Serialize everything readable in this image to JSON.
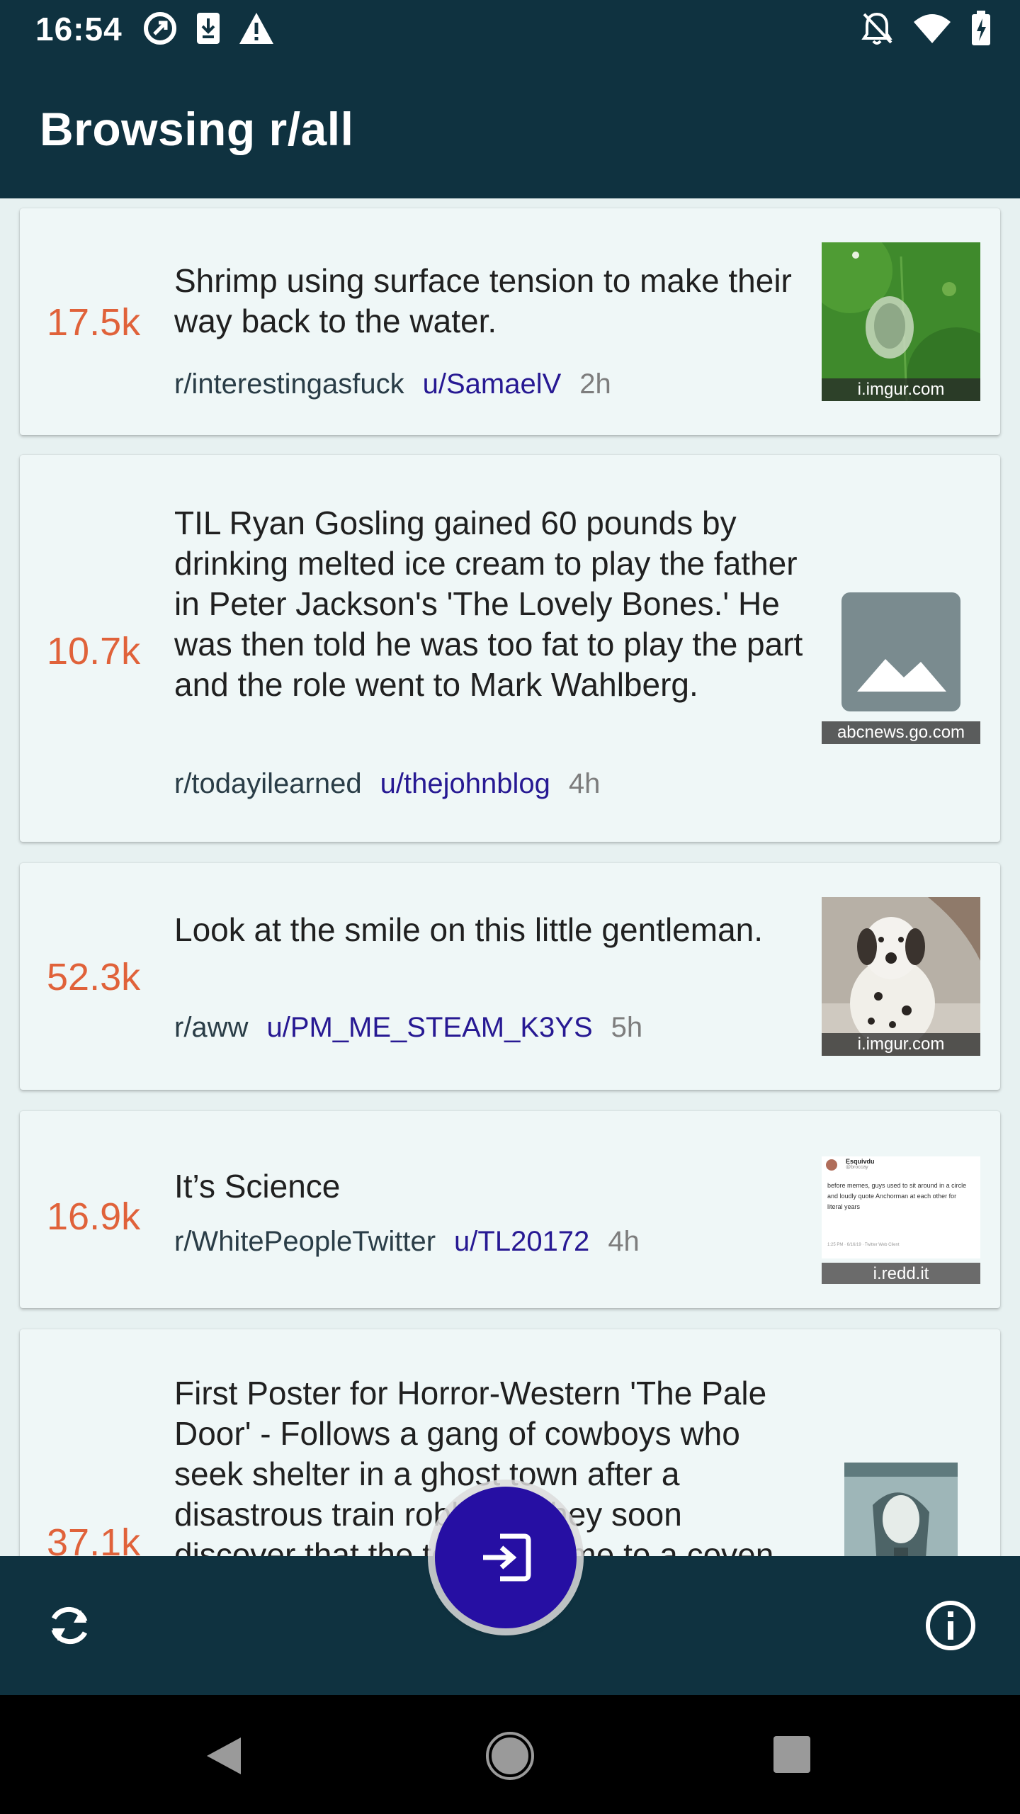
{
  "status": {
    "time": "16:54"
  },
  "appbar": {
    "title": "Browsing r/all"
  },
  "posts": [
    {
      "score": "17.5k",
      "title": "Shrimp using surface tension to make their way back to the water.",
      "subreddit": "r/interestingasfuck",
      "user": "u/SamaelV",
      "age": "2h",
      "domain": "i.imgur.com"
    },
    {
      "score": "10.7k",
      "title": "TIL Ryan Gosling gained 60 pounds by drinking melted ice cream to play the father in Peter Jackson's 'The Lovely Bones.' He was then told he was too fat to play the part and the role went to Mark Wahlberg.",
      "subreddit": "r/todayilearned",
      "user": "u/thejohnblog",
      "age": "4h",
      "domain": "abcnews.go.com"
    },
    {
      "score": "52.3k",
      "title": "Look at the smile on this little gentleman.",
      "subreddit": "r/aww",
      "user": "u/PM_ME_STEAM_K3YS",
      "age": "5h",
      "domain": "i.imgur.com"
    },
    {
      "score": "16.9k",
      "title": "It’s Science",
      "subreddit": "r/WhitePeopleTwitter",
      "user": "u/TL20172",
      "age": "4h",
      "domain": "i.redd.it",
      "tweet": {
        "name": "Esquivdu",
        "handle": "@broccay",
        "text": "before memes, guys used to sit around in a circle and loudly quote Anchorman at each other for literal years",
        "footer": "1:25 PM · 6/16/19 · Twitter Web Client"
      }
    },
    {
      "score": "37.1k",
      "title": "First Poster for Horror-Western 'The Pale Door' - Follows a gang of cowboys who seek shelter in a ghost town after a disastrous train robbery. They soon discover that the town is home to a coven of witches."
    }
  ],
  "colors": {
    "bar": "#0f3240",
    "score": "#e0623a",
    "user": "#271993",
    "fab": "#260fa3"
  }
}
